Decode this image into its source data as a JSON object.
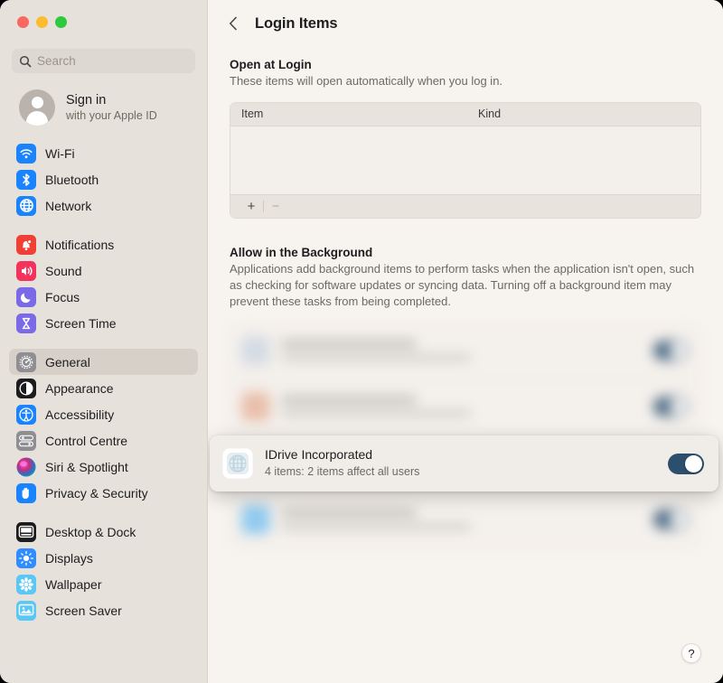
{
  "window": {
    "traffic_lights": [
      {
        "name": "close",
        "color": "#f9685f"
      },
      {
        "name": "minimize",
        "color": "#fbbd2e"
      },
      {
        "name": "zoom",
        "color": "#2dc93f"
      }
    ]
  },
  "sidebar": {
    "search": {
      "placeholder": "Search",
      "value": ""
    },
    "account": {
      "title": "Sign in",
      "subtitle": "with your Apple ID"
    },
    "groups": [
      {
        "items": [
          {
            "label": "Wi-Fi",
            "icon": "wifi-icon",
            "color": "#1a84ff",
            "selected": false
          },
          {
            "label": "Bluetooth",
            "icon": "bluetooth-icon",
            "color": "#1a84ff",
            "selected": false
          },
          {
            "label": "Network",
            "icon": "globe-icon",
            "color": "#1a84ff",
            "selected": false
          }
        ]
      },
      {
        "items": [
          {
            "label": "Notifications",
            "icon": "bell-icon",
            "color": "#f03f35",
            "selected": false
          },
          {
            "label": "Sound",
            "icon": "speaker-icon",
            "color": "#f5325b",
            "selected": false
          },
          {
            "label": "Focus",
            "icon": "moon-icon",
            "color": "#7b6ae8",
            "selected": false
          },
          {
            "label": "Screen Time",
            "icon": "hourglass-icon",
            "color": "#7b6ae8",
            "selected": false
          }
        ]
      },
      {
        "items": [
          {
            "label": "General",
            "icon": "gear-icon",
            "color": "#8e8e93",
            "selected": true
          },
          {
            "label": "Appearance",
            "icon": "contrast-icon",
            "color": "#1c1c1e",
            "selected": false
          },
          {
            "label": "Accessibility",
            "icon": "accessibility-icon",
            "color": "#1a84ff",
            "selected": false
          },
          {
            "label": "Control Centre",
            "icon": "control-centre-icon",
            "color": "#8e8e93",
            "selected": false
          },
          {
            "label": "Siri & Spotlight",
            "icon": "siri-icon",
            "color": "#3a2a5e",
            "selected": false
          },
          {
            "label": "Privacy & Security",
            "icon": "hand-icon",
            "color": "#1a84ff",
            "selected": false
          }
        ]
      },
      {
        "items": [
          {
            "label": "Desktop & Dock",
            "icon": "desktop-dock-icon",
            "color": "#1c1c1e",
            "selected": false
          },
          {
            "label": "Displays",
            "icon": "brightness-icon",
            "color": "#2f8dff",
            "selected": false
          },
          {
            "label": "Wallpaper",
            "icon": "wallpaper-icon",
            "color": "#5ac8f5",
            "selected": false
          },
          {
            "label": "Screen Saver",
            "icon": "screen-saver-icon",
            "color": "#5ac8f5",
            "selected": false
          }
        ]
      }
    ]
  },
  "main": {
    "header": {
      "back_label": "‹",
      "title": "Login Items"
    },
    "open_at_login": {
      "title": "Open at Login",
      "description": "These items will open automatically when you log in.",
      "columns": [
        "Item",
        "Kind"
      ],
      "rows": [],
      "add_label": "+",
      "remove_label": "−"
    },
    "allow_background": {
      "title": "Allow in the Background",
      "description": "Applications add background items to perform tasks when the application isn't open, such as checking for software updates or syncing data. Turning off a background item may prevent these tasks from being completed.",
      "blurred_rows": [
        {
          "toggle_on": true,
          "icon_color": "#cfd8e2"
        },
        {
          "toggle_on": true,
          "icon_color": "#e7b7a0"
        },
        {
          "toggle_on": false,
          "icon_color": "#dcd7d1"
        },
        {
          "toggle_on": true,
          "icon_color": "#7fc4f0"
        }
      ]
    },
    "focused_item": {
      "title": "IDrive Incorporated",
      "subtitle": "4 items: 2 items affect all users",
      "icon": "idrive-globe-icon",
      "toggle_on": true,
      "toggle_color": "#2b4f6d"
    },
    "help_label": "?"
  }
}
